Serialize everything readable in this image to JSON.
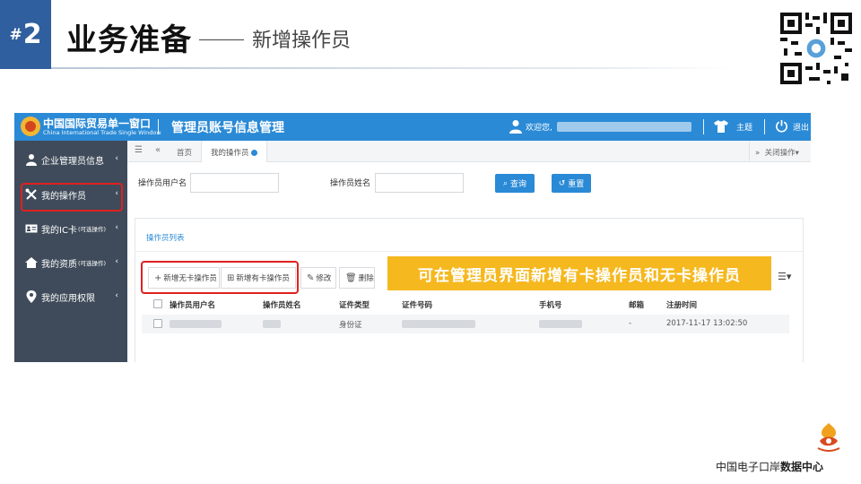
{
  "slide": {
    "number": "2",
    "hash": "#",
    "title": "业务准备",
    "subtitle": "新增操作员",
    "footer_prefix": "中国电子口岸",
    "footer_bold": "数据中心"
  },
  "app": {
    "brand_cn": "中国国际贸易单一窗口",
    "brand_en": "China International Trade Single Window",
    "module_title": "管理员账号信息管理",
    "welcome": "欢迎您,",
    "theme": "主题",
    "logout": "退出"
  },
  "sidebar": {
    "items": [
      {
        "label": "企业管理员信息",
        "small": "",
        "icon": "user-icon"
      },
      {
        "label": "我的操作员",
        "small": "",
        "icon": "tools-icon"
      },
      {
        "label": "我的IC卡",
        "small": "(可选操作)",
        "icon": "id-card-icon"
      },
      {
        "label": "我的资质",
        "small": "(可选操作)",
        "icon": "house-icon"
      },
      {
        "label": "我的应用权限",
        "small": "",
        "icon": "location-pin-icon"
      }
    ],
    "caret": "‹"
  },
  "tabs": {
    "home": "首页",
    "active": "我的操作员",
    "close_ops": "关闭操作▾"
  },
  "search": {
    "username_label": "操作员用户名",
    "name_label": "操作员姓名",
    "query_button": "查询",
    "reset_button": "重置"
  },
  "list": {
    "title": "操作员列表",
    "toolbar": {
      "add_no_card": "新增无卡操作员",
      "add_card": "新增有卡操作员",
      "edit": "修改",
      "delete": "删除"
    },
    "banner": "可在管理员界面新增有卡操作员和无卡操作员",
    "columns": [
      "操作员用户名",
      "操作员姓名",
      "证件类型",
      "证件号码",
      "手机号",
      "邮箱",
      "注册时间"
    ],
    "rows": [
      {
        "id_type": "身份证",
        "email": "-",
        "registered": "2017-11-17 13:02:50"
      }
    ]
  },
  "colors": {
    "topbar": "#2a8ad6",
    "sidebar": "#3f4b5a",
    "badge": "#2f5f9e",
    "banner": "#f5b81e",
    "highlight_box": "#e02020"
  }
}
